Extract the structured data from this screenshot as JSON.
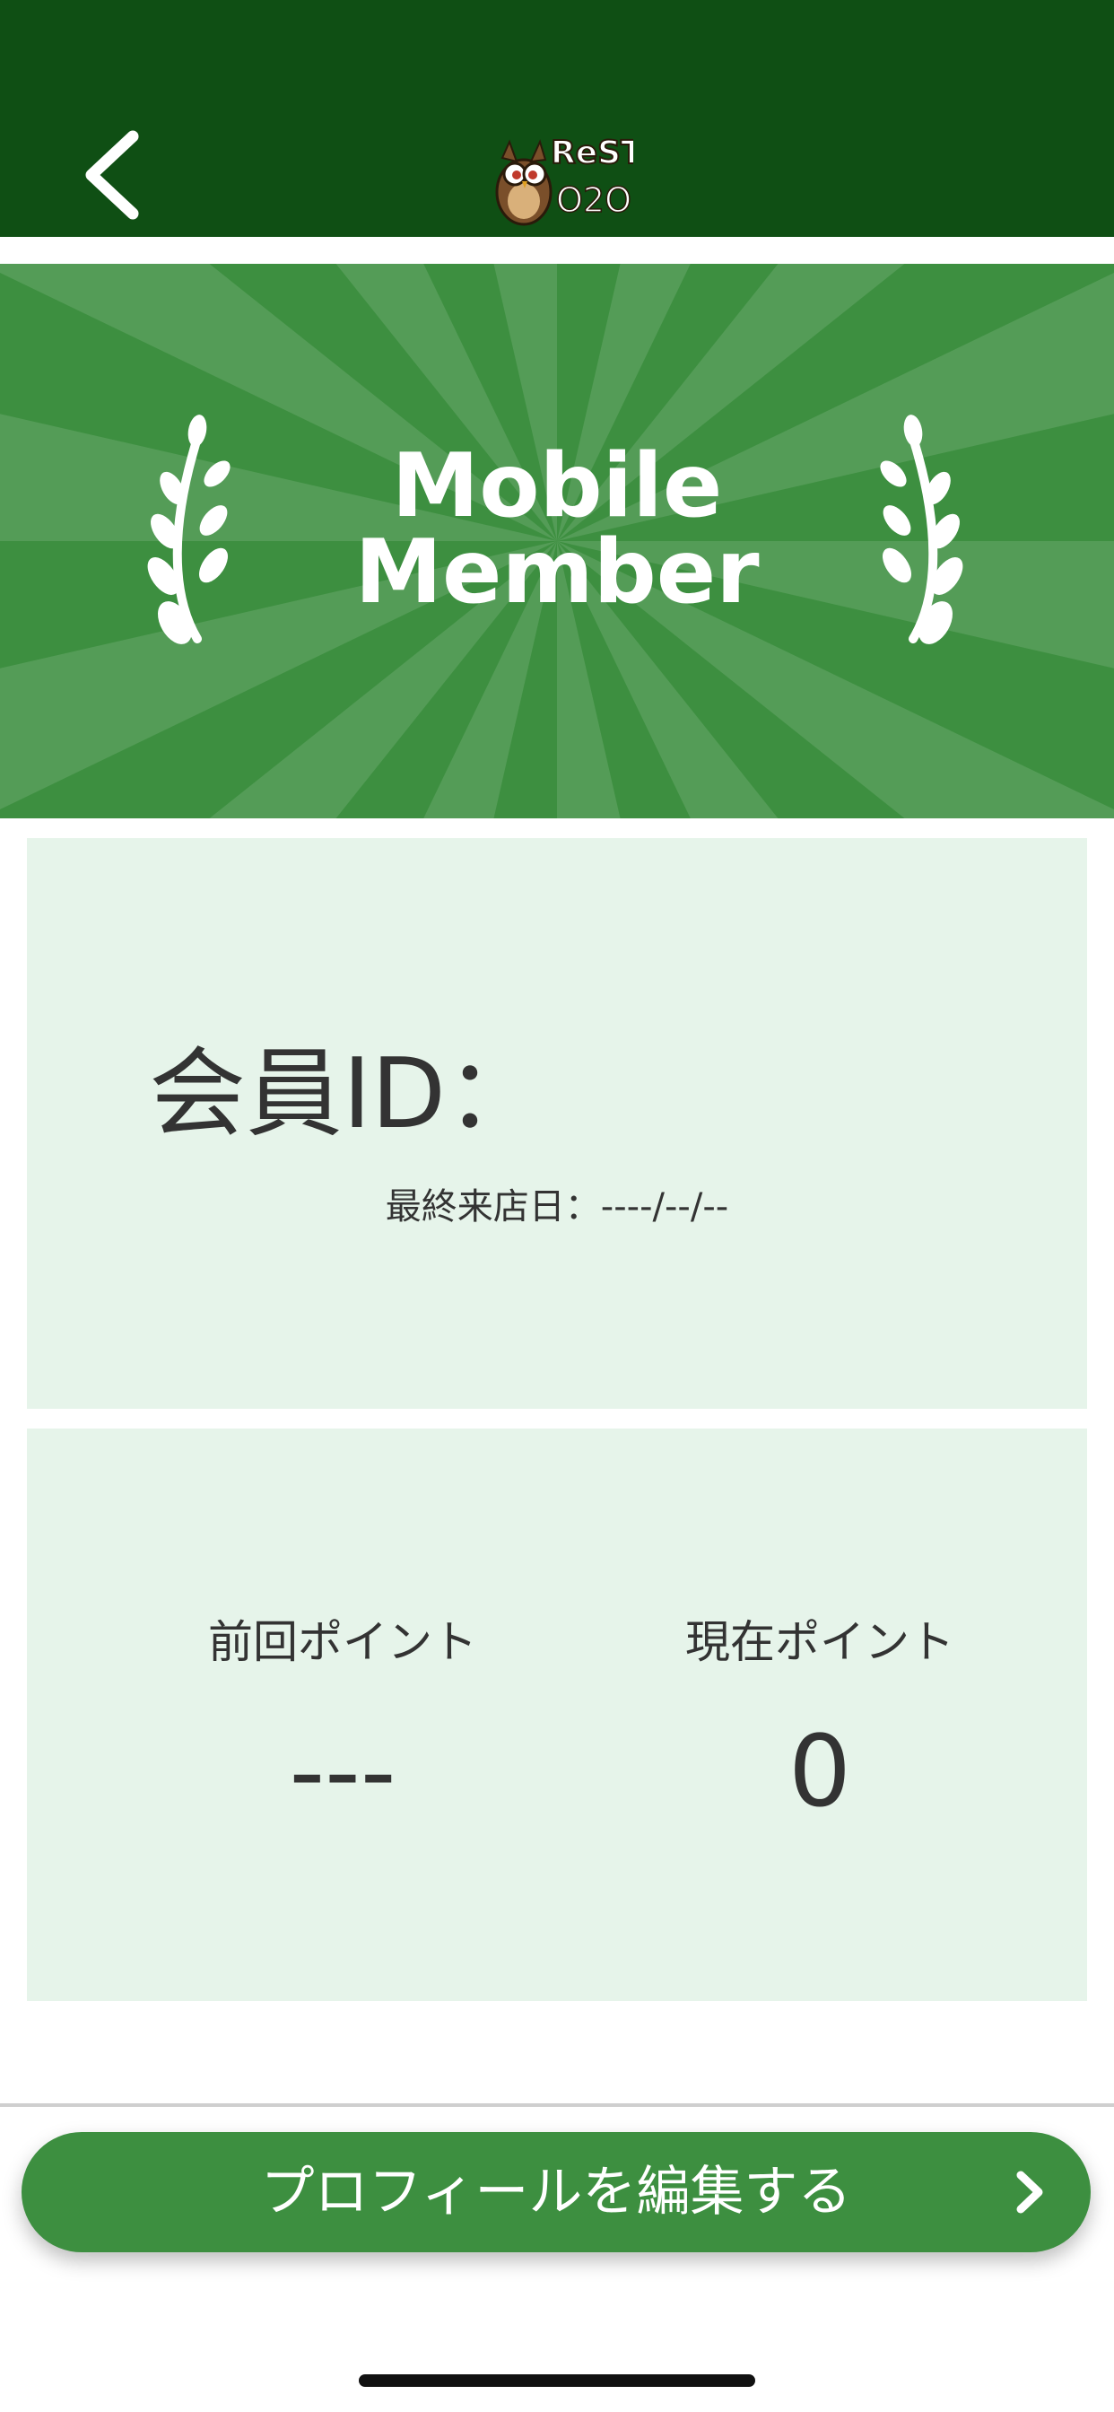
{
  "header": {
    "back_icon": "chevron-left-icon",
    "logo_text": "ReST O2O",
    "bg_color": "#0f4f14"
  },
  "banner": {
    "title_line1": "Mobile",
    "title_line2": "Member",
    "bg_color": "#3d8f40",
    "decoration": "laurel-icon"
  },
  "member_card": {
    "id_label": "会員ID：",
    "last_visit": "最終来店日：----/--/--",
    "bg_color": "#e6f4ea"
  },
  "points_card": {
    "previous_label": "前回ポイント",
    "previous_value": "---",
    "current_label": "現在ポイント",
    "current_value": "0"
  },
  "footer": {
    "edit_profile_label": "プロフィールを編集する",
    "chevron_icon": "chevron-right-icon",
    "accent_color": "#3d8f40"
  }
}
